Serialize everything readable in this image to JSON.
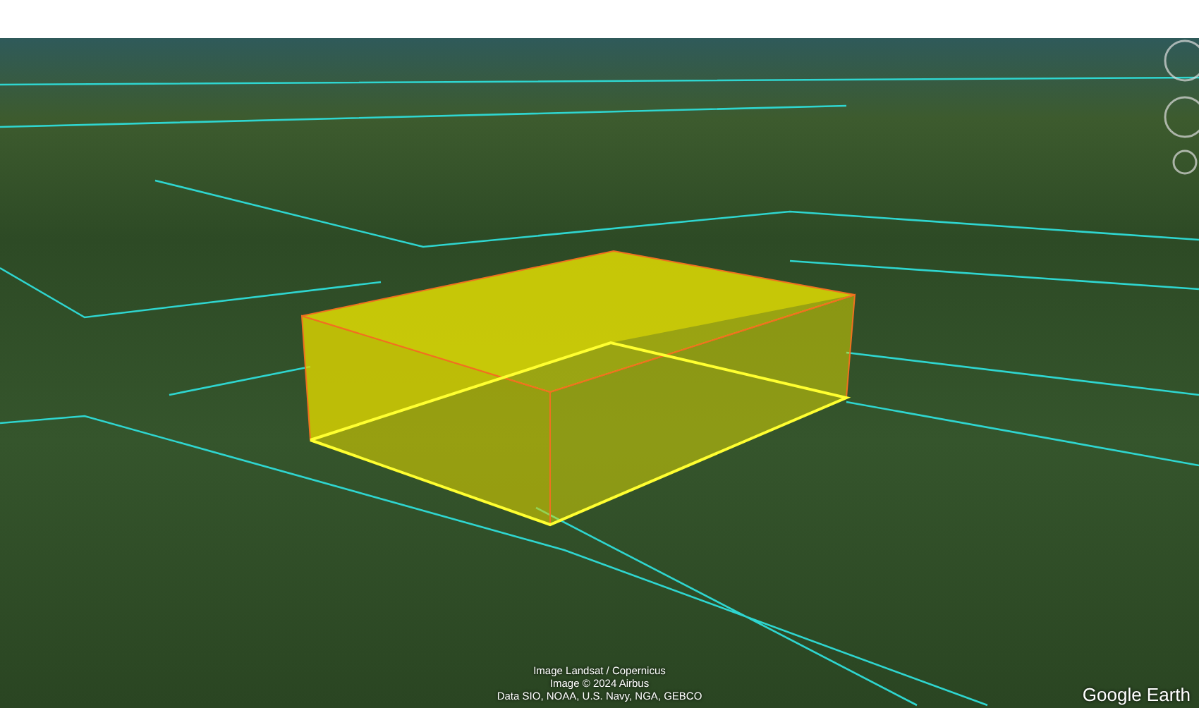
{
  "attribution": [
    "Image Landsat / Copernicus",
    "Image © 2024 Airbus",
    "Data SIO, NOAA, U.S. Navy, NGA, GEBCO"
  ],
  "logo": "Google Earth"
}
